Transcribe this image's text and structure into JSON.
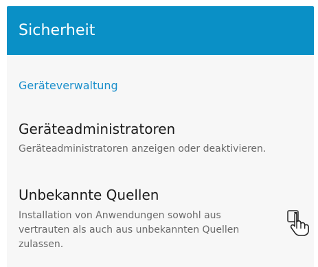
{
  "app_bar": {
    "title": "Sicherheit",
    "color": "#0a90c6"
  },
  "section": {
    "header": "Geräteverwaltung",
    "color": "#1a8fcb"
  },
  "items": [
    {
      "title": "Geräteadministratoren",
      "summary_lines": [
        "Geräteadministratoren anzeigen oder deaktivieren."
      ]
    },
    {
      "title": "Unbekannte Quellen",
      "summary_lines": [
        "Installation von Anwendungen sowohl aus",
        "vertrauten als auch aus unbekannten Quellen",
        "zulassen."
      ],
      "checked": false
    }
  ],
  "icons": {
    "cursor": "hand-pointer-icon",
    "checkbox": "checkbox-unchecked-icon"
  }
}
